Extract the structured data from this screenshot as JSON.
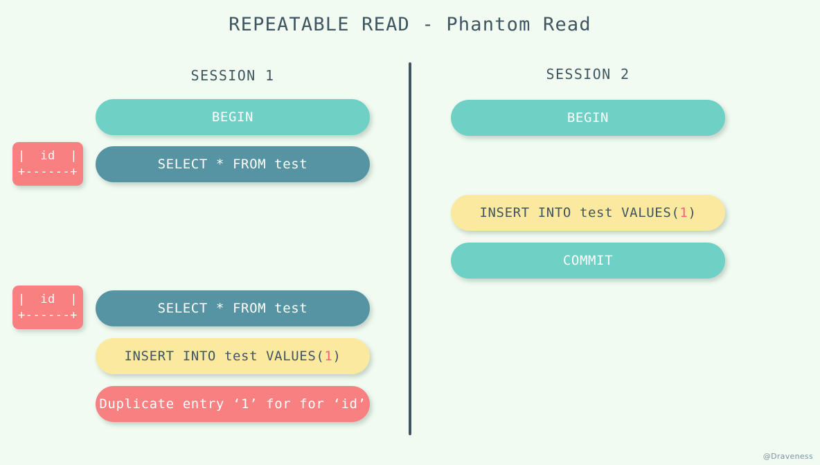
{
  "page": {
    "title": "REPEATABLE READ - Phantom Read",
    "background_color": "#f1fbf2",
    "text_color": "#3f5560",
    "watermark": "@Draveness"
  },
  "colors": {
    "teal": "#6fd0c5",
    "steel": "#5694a3",
    "yellow": "#fce9a0",
    "red": "#f98080",
    "accent": "#f2607a",
    "divider": "#3f5560"
  },
  "sessions": [
    {
      "label": "SESSION 1",
      "steps": [
        {
          "name": "begin",
          "text": "BEGIN",
          "style": "teal"
        },
        {
          "name": "select-1",
          "text": "SELECT * FROM test",
          "style": "steel"
        },
        {
          "name": "select-2",
          "text": "SELECT * FROM test",
          "style": "steel"
        },
        {
          "name": "insert",
          "text_before": "INSERT INTO test VALUES(",
          "accent": "1",
          "text_after": ")",
          "style": "yellow"
        },
        {
          "name": "error",
          "text": "Duplicate entry ‘1’ for for ‘id’",
          "style": "red"
        }
      ],
      "results": [
        {
          "name": "result-1",
          "header": "|  id  |",
          "separator": "+------+"
        },
        {
          "name": "result-2",
          "header": "|  id  |",
          "separator": "+------+"
        }
      ]
    },
    {
      "label": "SESSION 2",
      "steps": [
        {
          "name": "begin",
          "text": "BEGIN",
          "style": "teal"
        },
        {
          "name": "insert",
          "text_before": "INSERT INTO test VALUES(",
          "accent": "1",
          "text_after": ")",
          "style": "yellow"
        },
        {
          "name": "commit",
          "text": "COMMIT",
          "style": "teal"
        }
      ]
    }
  ]
}
